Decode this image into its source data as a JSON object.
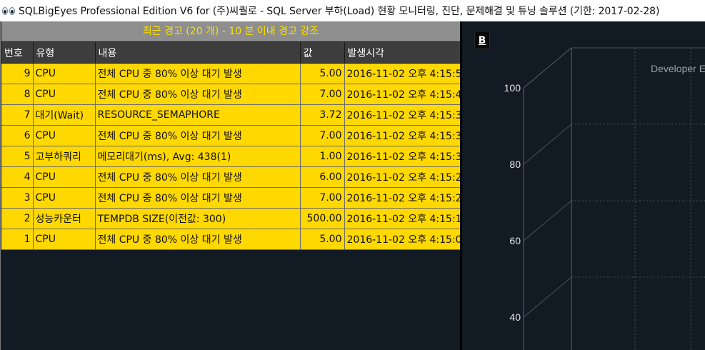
{
  "window": {
    "title": "SQLBigEyes Professional Edition V6 for (주)씨퀄로 - SQL Server 부하(Load) 현황 모니터링, 진단, 문제해결 및 튜닝 솔루션 (기한: 2017-02-28)",
    "icon": "binoculars-eyes-icon"
  },
  "alert_panel": {
    "header": "최근 경고 (20 개) - 10 분 이내 경고 강조",
    "columns": [
      "번호",
      "유형",
      "내용",
      "값",
      "발생시각"
    ],
    "rows": [
      {
        "num": "9",
        "type": "CPU",
        "content": "전체 CPU 중 80% 이상 대기 발생",
        "value": "5.00",
        "time": "2016-11-02 오후 4:15:5"
      },
      {
        "num": "8",
        "type": "CPU",
        "content": "전체 CPU 중 80% 이상 대기 발생",
        "value": "7.00",
        "time": "2016-11-02 오후 4:15:4"
      },
      {
        "num": "7",
        "type": "대기(Wait)",
        "content": "RESOURCE_SEMAPHORE",
        "value": "3.72",
        "time": "2016-11-02 오후 4:15:3"
      },
      {
        "num": "6",
        "type": "CPU",
        "content": "전체 CPU 중 80% 이상 대기 발생",
        "value": "7.00",
        "time": "2016-11-02 오후 4:15:3"
      },
      {
        "num": "5",
        "type": "고부하쿼리",
        "content": "메모리대기(ms), Avg: 438(1)",
        "value": "1.00",
        "time": "2016-11-02 오후 4:15:3"
      },
      {
        "num": "4",
        "type": "CPU",
        "content": "전체 CPU 중 80% 이상 대기 발생",
        "value": "6.00",
        "time": "2016-11-02 오후 4:15:2"
      },
      {
        "num": "3",
        "type": "CPU",
        "content": "전체 CPU 중 80% 이상 대기 발생",
        "value": "7.00",
        "time": "2016-11-02 오후 4:15:2"
      },
      {
        "num": "2",
        "type": "성능카운터",
        "content": "TEMPDB SIZE(이전값: 300)",
        "value": "500.00",
        "time": "2016-11-02 오후 4:15:1"
      },
      {
        "num": "1",
        "type": "CPU",
        "content": "전체 CPU 중 80% 이상 대기 발생",
        "value": "5.00",
        "time": "2016-11-02 오후 4:15:0"
      }
    ],
    "colors": {
      "row_background": "#ffd800",
      "header_text": "#ffe000",
      "panel_background": "#121a24"
    }
  },
  "chart_panel": {
    "badge": "B",
    "legend_text": "Developer E"
  },
  "chart_data": {
    "type": "bar",
    "y_ticks": [
      100,
      80,
      60,
      40
    ],
    "grid": true,
    "style": "3d",
    "legend": "Developer E"
  }
}
